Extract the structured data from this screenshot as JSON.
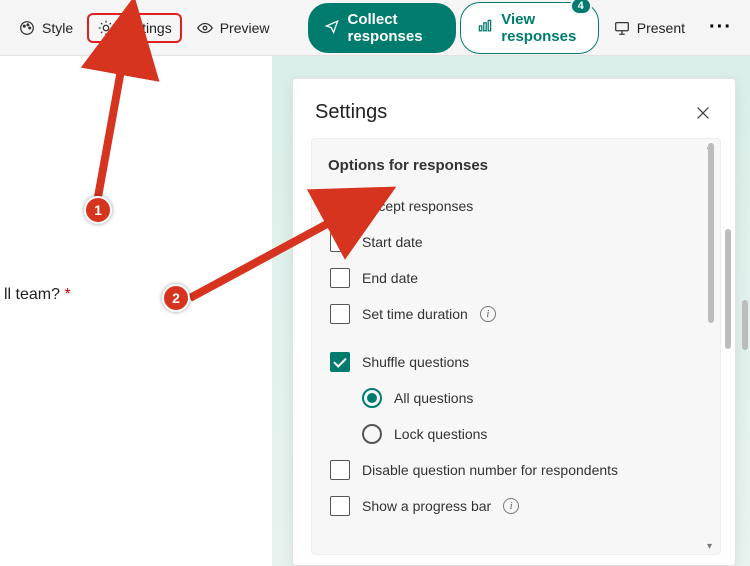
{
  "toolbar": {
    "style_label": "Style",
    "settings_label": "Settings",
    "preview_label": "Preview",
    "collect_label": "Collect responses",
    "view_label": "View responses",
    "view_badge": "4",
    "present_label": "Present"
  },
  "question": {
    "text_fragment": "ll team? ",
    "required_mark": "*"
  },
  "panel": {
    "title": "Settings",
    "section_title": "Options for responses",
    "opts": {
      "accept": "Accept responses",
      "start_date": "Start date",
      "end_date": "End date",
      "time_duration": "Set time duration",
      "shuffle": "Shuffle questions",
      "shuffle_all": "All questions",
      "shuffle_lock": "Lock questions",
      "disable_qnum": "Disable question number for respondents",
      "progress_bar": "Show a progress bar"
    }
  },
  "annotations": {
    "a1": "1",
    "a2": "2"
  },
  "colors": {
    "accent": "#007c6e",
    "highlight": "#e02020"
  }
}
